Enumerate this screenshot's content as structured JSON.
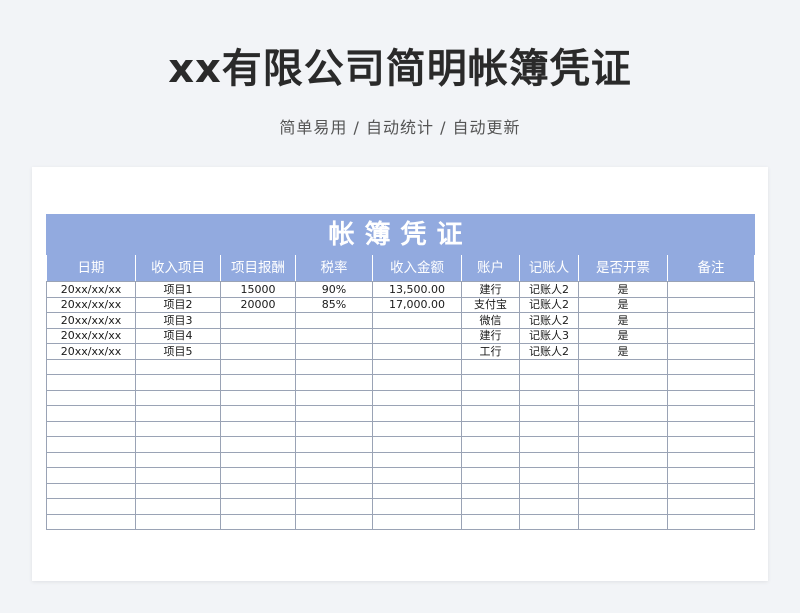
{
  "page": {
    "title": "xx有限公司简明帐簿凭证",
    "subtitle": "简单易用 / 自动统计 / 自动更新"
  },
  "sheet": {
    "banner": "帐簿凭证",
    "columns": [
      "日期",
      "收入项目",
      "项目报酬",
      "税率",
      "收入金额",
      "账户",
      "记账人",
      "是否开票",
      "备注"
    ],
    "rows": [
      [
        "20xx/xx/xx",
        "项目1",
        "15000",
        "90%",
        "13,500.00",
        "建行",
        "记账人2",
        "是",
        ""
      ],
      [
        "20xx/xx/xx",
        "项目2",
        "20000",
        "85%",
        "17,000.00",
        "支付宝",
        "记账人2",
        "是",
        ""
      ],
      [
        "20xx/xx/xx",
        "项目3",
        "",
        "",
        "",
        "微信",
        "记账人2",
        "是",
        ""
      ],
      [
        "20xx/xx/xx",
        "项目4",
        "",
        "",
        "",
        "建行",
        "记账人3",
        "是",
        ""
      ],
      [
        "20xx/xx/xx",
        "项目5",
        "",
        "",
        "",
        "工行",
        "记账人2",
        "是",
        ""
      ],
      [
        "",
        "",
        "",
        "",
        "",
        "",
        "",
        "",
        ""
      ],
      [
        "",
        "",
        "",
        "",
        "",
        "",
        "",
        "",
        ""
      ],
      [
        "",
        "",
        "",
        "",
        "",
        "",
        "",
        "",
        ""
      ],
      [
        "",
        "",
        "",
        "",
        "",
        "",
        "",
        "",
        ""
      ],
      [
        "",
        "",
        "",
        "",
        "",
        "",
        "",
        "",
        ""
      ],
      [
        "",
        "",
        "",
        "",
        "",
        "",
        "",
        "",
        ""
      ],
      [
        "",
        "",
        "",
        "",
        "",
        "",
        "",
        "",
        ""
      ],
      [
        "",
        "",
        "",
        "",
        "",
        "",
        "",
        "",
        ""
      ],
      [
        "",
        "",
        "",
        "",
        "",
        "",
        "",
        "",
        ""
      ],
      [
        "",
        "",
        "",
        "",
        "",
        "",
        "",
        "",
        ""
      ],
      [
        "",
        "",
        "",
        "",
        "",
        "",
        "",
        "",
        ""
      ]
    ]
  },
  "colors": {
    "header_bg": "#92aadf",
    "grid_line": "#9aa3b5",
    "page_bg": "#f2f4f7"
  }
}
